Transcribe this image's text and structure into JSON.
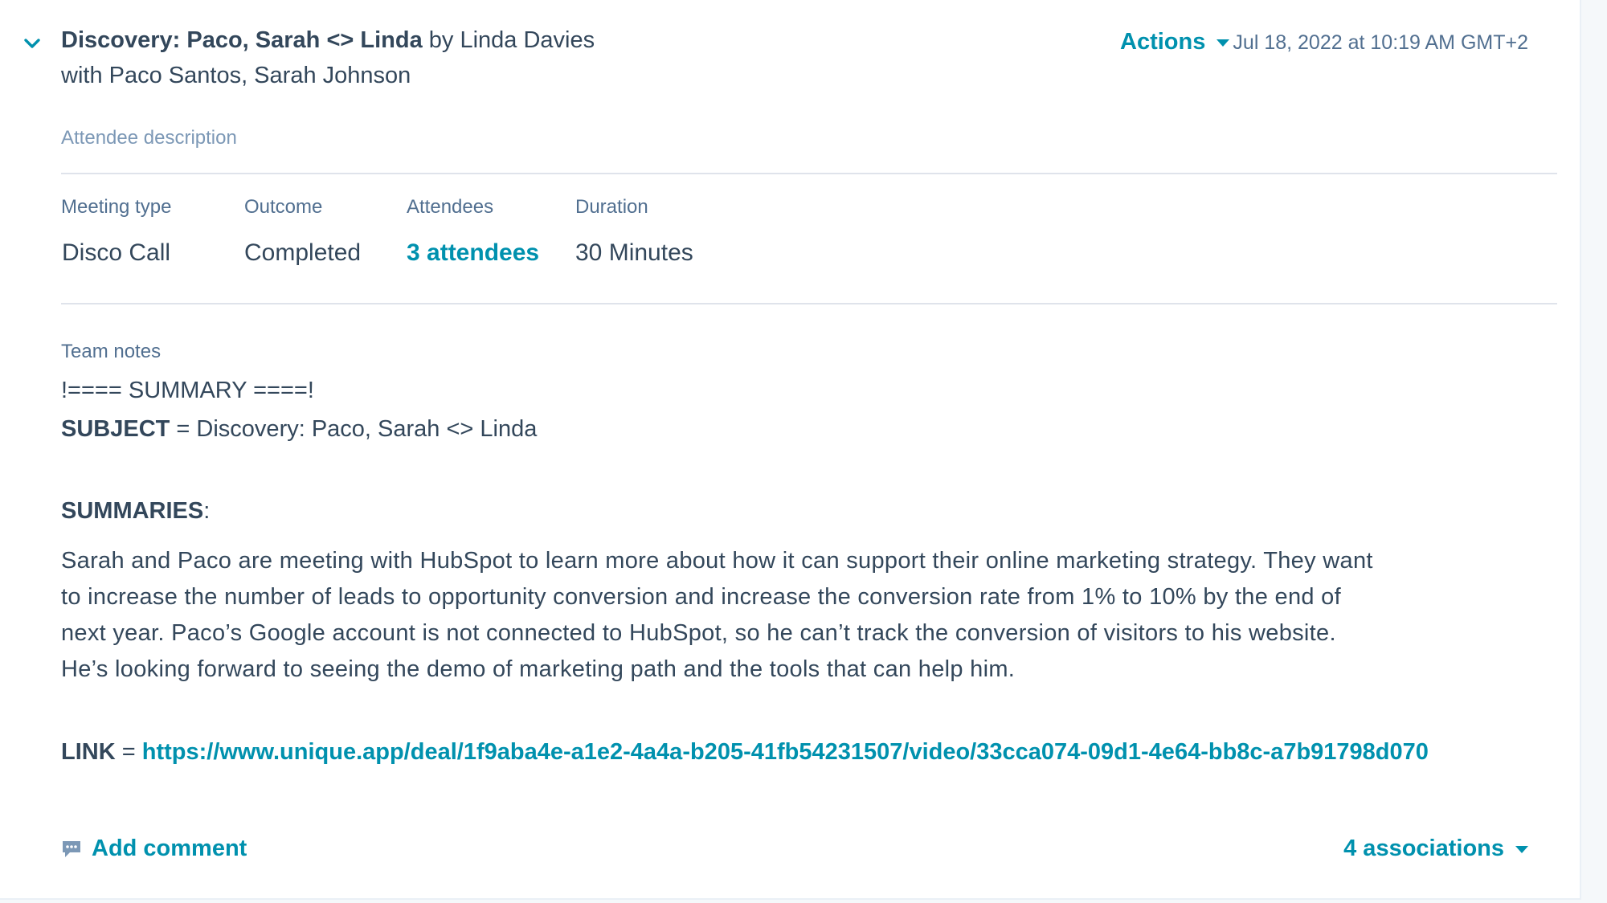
{
  "header": {
    "subject": "Discovery: Paco, Sarah <> Linda",
    "by_prefix": " by ",
    "author": "Linda Davies",
    "with_line": "with Paco Santos, Sarah Johnson",
    "actions_label": "Actions",
    "timestamp": "Jul 18, 2022 at 10:19 AM GMT+2"
  },
  "attendee_description_label": "Attendee description",
  "properties": {
    "meeting_type": {
      "label": "Meeting type",
      "value": "Disco Call"
    },
    "outcome": {
      "label": "Outcome",
      "value": "Completed"
    },
    "attendees": {
      "label": "Attendees",
      "value": "3 attendees"
    },
    "duration": {
      "label": "Duration",
      "value": "30 Minutes"
    }
  },
  "notes": {
    "label": "Team notes",
    "summary_header": "!==== SUMMARY ====!",
    "subject_key": "SUBJECT",
    "subject_sep": " = ",
    "subject_value": "Discovery: Paco, Sarah <> Linda",
    "summaries_key": "SUMMARIES",
    "summaries_colon": ":",
    "summary_lines": [
      "Sarah and Paco are meeting with HubSpot to learn more about how it can support their online marketing strategy. They want",
      "to increase the number of leads to opportunity conversion and increase the conversion rate from 1% to 10% by the end of",
      "next year. Paco’s Google account is not connected to HubSpot, so he can’t track the conversion of visitors to his website.",
      "He’s looking forward to seeing the demo of marketing path and the tools that can help him."
    ],
    "link_key": "LINK",
    "link_sep": " = ",
    "link_url": "https://www.unique.app/deal/1f9aba4e-a1e2-4a4a-b205-41fb54231507/video/33cca074-09d1-4e64-bb8c-a7b91798d070"
  },
  "footer": {
    "add_comment_label": "Add comment",
    "associations_label": "4 associations"
  },
  "colors": {
    "accent": "#0091ae",
    "text": "#33475b",
    "muted": "#516f90",
    "divider": "#dfe3eb"
  },
  "icons": {
    "collapse": "chevron-down-icon",
    "actions_caret": "caret-down-icon",
    "comment": "comment-icon",
    "associations_caret": "caret-down-icon"
  }
}
